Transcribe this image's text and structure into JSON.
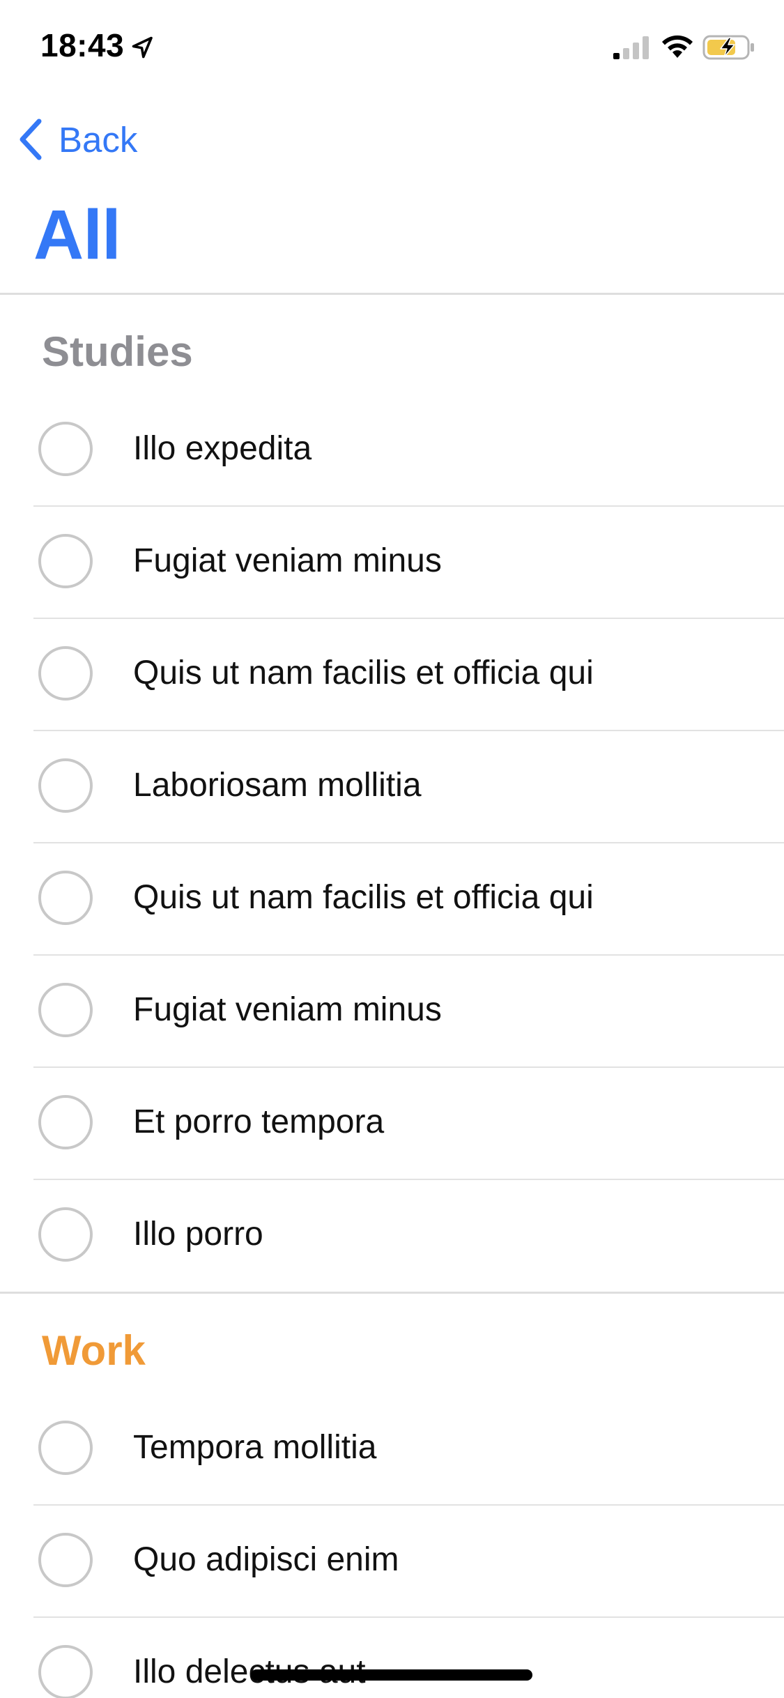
{
  "status_bar": {
    "time": "18:43",
    "icons": [
      "location-arrow-icon",
      "cellular-signal-icon",
      "wifi-icon",
      "battery-charging-icon"
    ]
  },
  "nav": {
    "back_label": "Back"
  },
  "title": "All",
  "colors": {
    "accent": "#3478F6",
    "studies": "#8E8E93",
    "work": "#F09A37"
  },
  "sections": [
    {
      "name": "Studies",
      "tasks": [
        "Illo expedita",
        "Fugiat veniam minus",
        "Quis ut nam facilis et officia qui",
        "Laboriosam mollitia",
        "Quis ut nam facilis et officia qui",
        "Fugiat veniam minus",
        "Et porro tempora",
        "Illo porro"
      ]
    },
    {
      "name": "Work",
      "tasks": [
        "Tempora mollitia",
        "Quo adipisci enim",
        "Illo delectus aut"
      ]
    }
  ]
}
